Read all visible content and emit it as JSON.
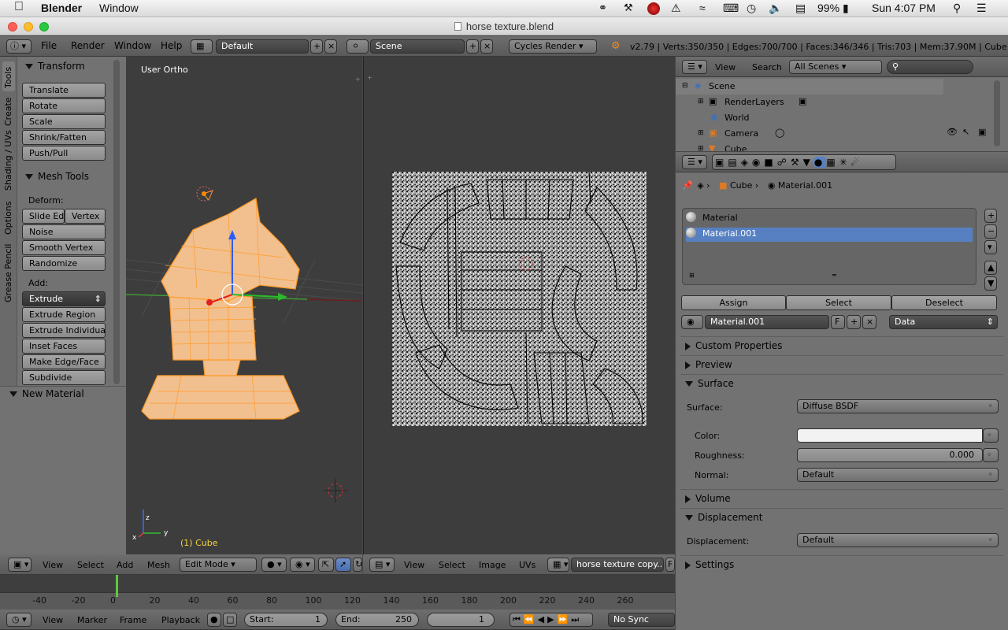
{
  "macbar": {
    "app": "Blender",
    "menu": "Window",
    "battery": "99%",
    "clock": "Sun 4:07 PM"
  },
  "window": {
    "title": "horse texture.blend"
  },
  "info_header": {
    "menus": [
      "File",
      "Render",
      "Window",
      "Help"
    ],
    "screen": "Default",
    "scene": "Scene",
    "engine": "Cycles Render",
    "stats": "v2.79 | Verts:350/350 | Edges:700/700 | Faces:346/346 | Tris:703 | Mem:37.90M | Cube"
  },
  "toolshelf": {
    "tabs": [
      "Tools",
      "Create",
      "Shading / UVs",
      "Options",
      "Grease Pencil"
    ],
    "transform_title": "Transform",
    "transform_buttons": [
      "Translate",
      "Rotate",
      "Scale",
      "Shrink/Fatten",
      "Push/Pull"
    ],
    "meshtools_title": "Mesh Tools",
    "deform_label": "Deform:",
    "slide_edge": "Slide Ed",
    "vertex": "Vertex",
    "deform_buttons": [
      "Noise",
      "Smooth Vertex",
      "Randomize"
    ],
    "add_label": "Add:",
    "extrude": "Extrude",
    "add_buttons": [
      "Extrude Region",
      "Extrude Individual",
      "Inset Faces",
      "Make Edge/Face",
      "Subdivide"
    ],
    "operator_title": "New Material"
  },
  "viewport": {
    "label": "User Ortho",
    "object_label": "(1) Cube",
    "header": {
      "menus": [
        "View",
        "Select",
        "Add",
        "Mesh"
      ],
      "mode": "Edit Mode"
    }
  },
  "uv_editor": {
    "header": {
      "menus": [
        "View",
        "Select",
        "Image",
        "UVs"
      ],
      "image": "horse texture copy....",
      "trailing": "F"
    }
  },
  "outliner": {
    "header": {
      "view": "View",
      "search": "Search",
      "filter": "All Scenes"
    },
    "items": [
      "Scene",
      "RenderLayers",
      "World",
      "Camera",
      "Cube"
    ]
  },
  "properties": {
    "breadcrumb": {
      "object": "Cube",
      "material": "Material.001"
    },
    "slots": [
      "Material",
      "Material.001"
    ],
    "assign": "Assign",
    "select": "Select",
    "deselect": "Deselect",
    "material_name": "Material.001",
    "fake_user": "F",
    "link": "Data",
    "panels": {
      "custom_props": "Custom Properties",
      "preview": "Preview",
      "surface": "Surface",
      "volume": "Volume",
      "displacement": "Displacement",
      "settings": "Settings"
    },
    "surface_label": "Surface:",
    "surface_value": "Diffuse BSDF",
    "color_label": "Color:",
    "roughness_label": "Roughness:",
    "roughness_value": "0.000",
    "normal_label": "Normal:",
    "normal_value": "Default",
    "displacement_label": "Displacement:",
    "displacement_value": "Default"
  },
  "timeline": {
    "ruler": [
      "-40",
      "-20",
      "0",
      "20",
      "40",
      "60",
      "80",
      "100",
      "120",
      "140",
      "160",
      "180",
      "200",
      "220",
      "240",
      "260"
    ],
    "current_frame_ruler": 0,
    "menus": [
      "View",
      "Marker",
      "Frame",
      "Playback"
    ],
    "start_label": "Start:",
    "start": "1",
    "end_label": "End:",
    "end": "250",
    "frame": "1",
    "sync": "No Sync"
  },
  "colors": {
    "accent": "#5680c2",
    "selection": "#ff9a26",
    "uv_bg": "#a8a8a8"
  }
}
